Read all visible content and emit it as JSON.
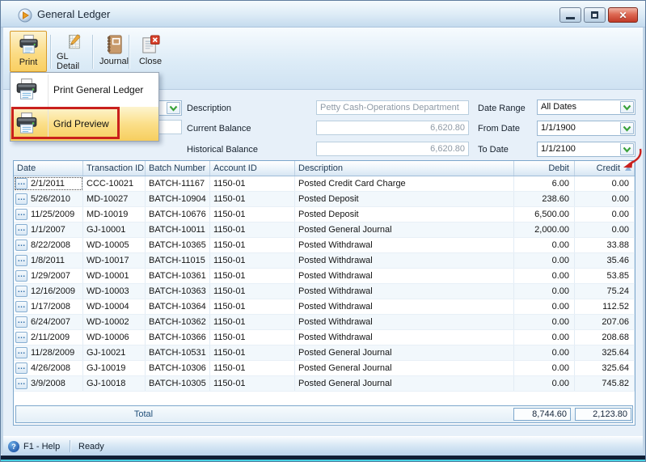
{
  "window": {
    "title": "General Ledger"
  },
  "titlebar": {
    "minimize": "minimize",
    "maximize": "maximize",
    "close_x": "✕"
  },
  "toolbar": {
    "print_label": "Print",
    "gl_detail_label": "GL Detail",
    "journal_label": "Journal",
    "close_label": "Close"
  },
  "menu": {
    "print_general_ledger": "Print General Ledger",
    "grid_preview": "Grid Preview"
  },
  "form": {
    "description_label": "Description",
    "description_value": "Petty Cash-Operations Department",
    "current_balance_label": "Current Balance",
    "current_balance_value": "6,620.80",
    "historical_balance_label": "Historical Balance",
    "historical_balance_value": "6,620.80",
    "date_range_label": "Date Range",
    "date_range_value": "All Dates",
    "from_date_label": "From Date",
    "from_date_value": "1/1/1900",
    "to_date_label": "To Date",
    "to_date_value": "1/1/2100"
  },
  "grid": {
    "columns": [
      "Date",
      "Transaction ID",
      "Batch Number",
      "Account ID",
      "Description",
      "Debit",
      "Credit"
    ],
    "rows": [
      {
        "date": "2/1/2011",
        "txn": "CCC-10021",
        "batch": "BATCH-11167",
        "acct": "1150-01",
        "desc": "Posted Credit Card Charge",
        "debit": "6.00",
        "credit": "0.00"
      },
      {
        "date": "5/26/2010",
        "txn": "MD-10027",
        "batch": "BATCH-10904",
        "acct": "1150-01",
        "desc": "Posted Deposit",
        "debit": "238.60",
        "credit": "0.00"
      },
      {
        "date": "11/25/2009",
        "txn": "MD-10019",
        "batch": "BATCH-10676",
        "acct": "1150-01",
        "desc": "Posted Deposit",
        "debit": "6,500.00",
        "credit": "0.00"
      },
      {
        "date": "1/1/2007",
        "txn": "GJ-10001",
        "batch": "BATCH-10011",
        "acct": "1150-01",
        "desc": "Posted General Journal",
        "debit": "2,000.00",
        "credit": "0.00"
      },
      {
        "date": "8/22/2008",
        "txn": "WD-10005",
        "batch": "BATCH-10365",
        "acct": "1150-01",
        "desc": "Posted Withdrawal",
        "debit": "0.00",
        "credit": "33.88"
      },
      {
        "date": "1/8/2011",
        "txn": "WD-10017",
        "batch": "BATCH-11015",
        "acct": "1150-01",
        "desc": "Posted Withdrawal",
        "debit": "0.00",
        "credit": "35.46"
      },
      {
        "date": "1/29/2007",
        "txn": "WD-10001",
        "batch": "BATCH-10361",
        "acct": "1150-01",
        "desc": "Posted Withdrawal",
        "debit": "0.00",
        "credit": "53.85"
      },
      {
        "date": "12/16/2009",
        "txn": "WD-10003",
        "batch": "BATCH-10363",
        "acct": "1150-01",
        "desc": "Posted Withdrawal",
        "debit": "0.00",
        "credit": "75.24"
      },
      {
        "date": "1/17/2008",
        "txn": "WD-10004",
        "batch": "BATCH-10364",
        "acct": "1150-01",
        "desc": "Posted Withdrawal",
        "debit": "0.00",
        "credit": "112.52"
      },
      {
        "date": "6/24/2007",
        "txn": "WD-10002",
        "batch": "BATCH-10362",
        "acct": "1150-01",
        "desc": "Posted Withdrawal",
        "debit": "0.00",
        "credit": "207.06"
      },
      {
        "date": "2/11/2009",
        "txn": "WD-10006",
        "batch": "BATCH-10366",
        "acct": "1150-01",
        "desc": "Posted Withdrawal",
        "debit": "0.00",
        "credit": "208.68"
      },
      {
        "date": "11/28/2009",
        "txn": "GJ-10021",
        "batch": "BATCH-10531",
        "acct": "1150-01",
        "desc": "Posted General Journal",
        "debit": "0.00",
        "credit": "325.64"
      },
      {
        "date": "4/26/2008",
        "txn": "GJ-10019",
        "batch": "BATCH-10306",
        "acct": "1150-01",
        "desc": "Posted General Journal",
        "debit": "0.00",
        "credit": "325.64"
      },
      {
        "date": "3/9/2008",
        "txn": "GJ-10018",
        "batch": "BATCH-10305",
        "acct": "1150-01",
        "desc": "Posted General Journal",
        "debit": "0.00",
        "credit": "745.82"
      }
    ],
    "total_label": "Total",
    "total_debit": "8,744.60",
    "total_credit": "2,123.80"
  },
  "statusbar": {
    "help_label": "F1 - Help",
    "status": "Ready"
  },
  "colors": {
    "toolbar_selected": "#f9cf62",
    "menu_highlight": "#f6ce5e",
    "annotation_red": "#c9201d",
    "grid_border": "#7da7cc",
    "close_button_red": "#c23a27"
  }
}
